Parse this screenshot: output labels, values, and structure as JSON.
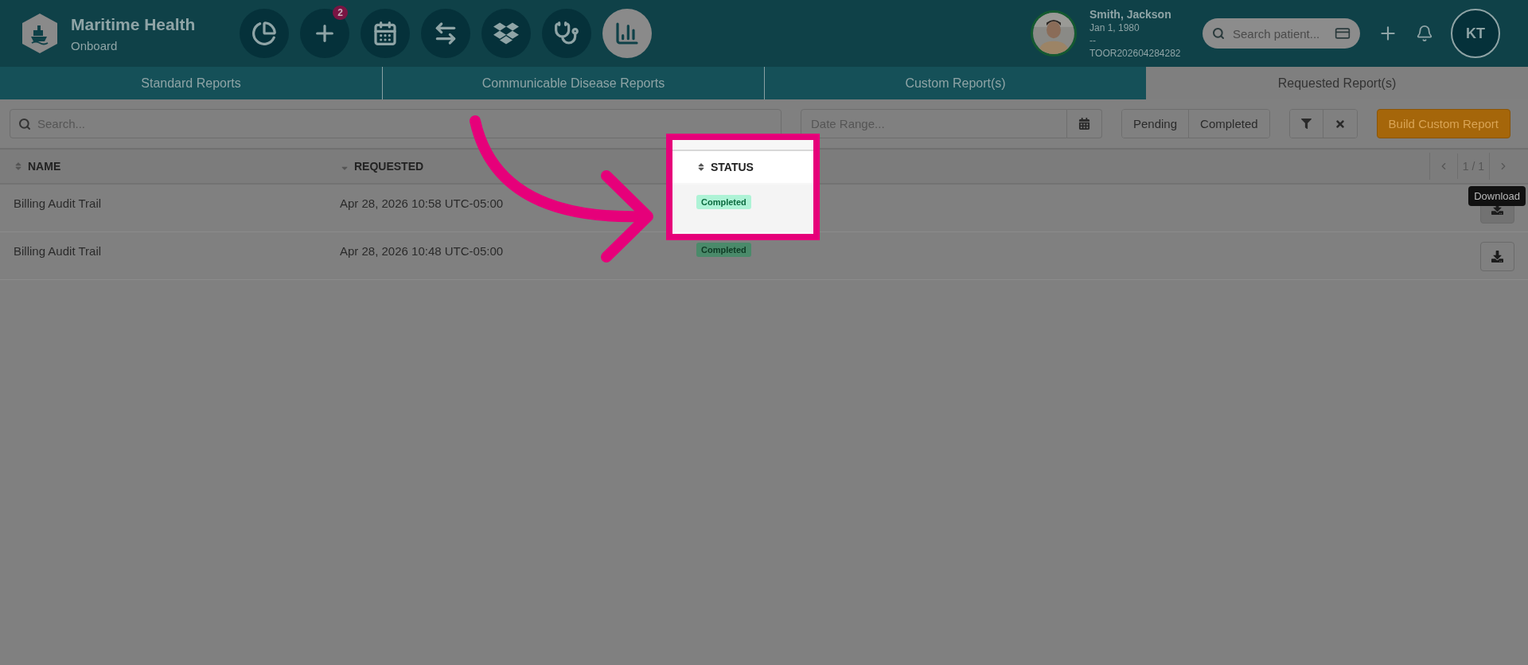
{
  "app": {
    "name": "Maritime Health",
    "subtitle": "Onboard"
  },
  "nav_icons": [
    {
      "kind": "dashboard",
      "selected": false
    },
    {
      "kind": "add",
      "selected": false,
      "badge": "2"
    },
    {
      "kind": "calendar",
      "selected": false
    },
    {
      "kind": "transfer",
      "selected": false
    },
    {
      "kind": "inventory",
      "selected": false
    },
    {
      "kind": "clinical",
      "selected": false
    },
    {
      "kind": "reports",
      "selected": true
    }
  ],
  "patient": {
    "name": "Smith, Jackson",
    "dob": "Jan 1, 1980",
    "line_3": "--",
    "id": "TOOR202604284282"
  },
  "patient_search": {
    "placeholder": "Search patient..."
  },
  "user": {
    "initials": "KT"
  },
  "tabs": [
    {
      "label": "Standard Reports",
      "selected": false
    },
    {
      "label": "Communicable Disease Reports",
      "selected": false
    },
    {
      "label": "Custom Report(s)",
      "selected": false
    },
    {
      "label": "Requested Report(s)",
      "selected": true
    }
  ],
  "search": {
    "placeholder": "Search..."
  },
  "date_range": {
    "placeholder": "Date Range..."
  },
  "status_filters": [
    "Pending",
    "Completed"
  ],
  "build_button": "Build Custom Report",
  "table": {
    "columns": [
      {
        "label": "NAME",
        "sorted_descending": false,
        "highlighted": false
      },
      {
        "label": "REQUESTED",
        "sorted_descending": true,
        "highlighted": false
      },
      {
        "label": "STATUS",
        "sorted_descending": false,
        "highlighted": true
      }
    ],
    "pagination": "1 / 1",
    "rows": [
      {
        "name": "Billing Audit Trail",
        "requested": "Apr 28, 2026 10:58 UTC-05:00",
        "status": "Completed",
        "highlighted": true
      },
      {
        "name": "Billing Audit Trail",
        "requested": "Apr 28, 2026 10:48 UTC-05:00",
        "status": "Completed",
        "highlighted": false
      }
    ]
  },
  "tooltip": "Download"
}
